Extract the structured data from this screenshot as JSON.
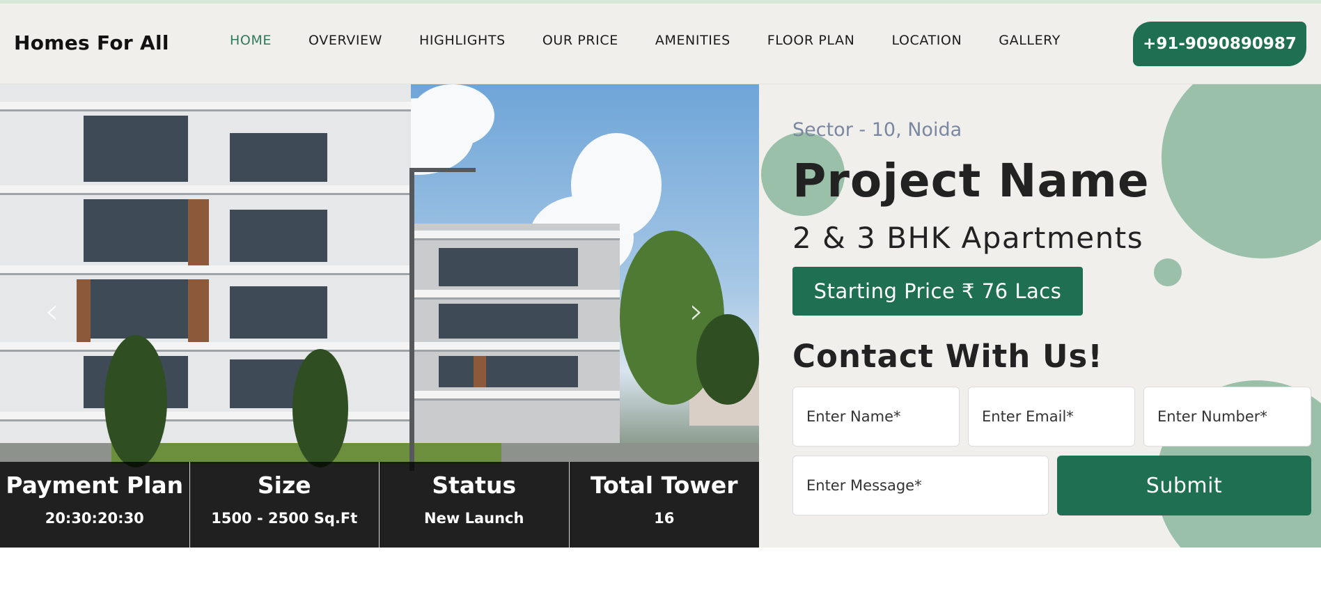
{
  "header": {
    "brand": "Homes For All",
    "nav": [
      {
        "label": "HOME",
        "active": true
      },
      {
        "label": "OVERVIEW"
      },
      {
        "label": "HIGHLIGHTS"
      },
      {
        "label": "OUR PRICE"
      },
      {
        "label": "AMENITIES"
      },
      {
        "label": "FLOOR PLAN"
      },
      {
        "label": "LOCATION"
      },
      {
        "label": "GALLERY"
      }
    ],
    "phone": "+91-9090890987"
  },
  "hero": {
    "prev_icon": "chevron-left-icon",
    "next_icon": "chevron-right-icon",
    "stats": [
      {
        "title": "Payment Plan",
        "value": "20:30:20:30"
      },
      {
        "title": "Size",
        "value": "1500 - 2500 Sq.Ft"
      },
      {
        "title": "Status",
        "value": "New Launch"
      },
      {
        "title": "Total Tower",
        "value": "16"
      }
    ]
  },
  "panel": {
    "location": "Sector - 10, Noida",
    "project_name": "Project Name",
    "configuration": "2 & 3 BHK Apartments",
    "price_label": "Starting Price ₹ 76 Lacs",
    "contact_title": "Contact With Us!",
    "form": {
      "name_placeholder": "Enter Name*",
      "email_placeholder": "Enter Email*",
      "number_placeholder": "Enter Number*",
      "message_placeholder": "Enter Message*",
      "submit_label": "Submit"
    }
  },
  "colors": {
    "brand_green": "#1f7052",
    "accent_circle": "#9ac0aa",
    "active_nav": "#2e7a5c",
    "panel_bg": "#f0efec"
  }
}
